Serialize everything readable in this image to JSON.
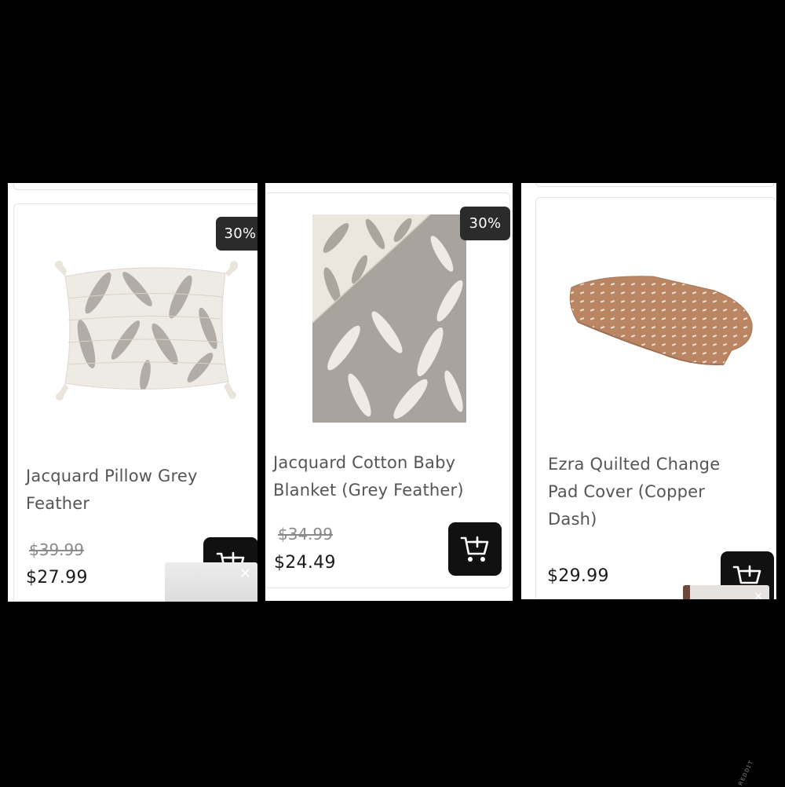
{
  "products": [
    {
      "title": "Jacquard Pillow Grey Feather",
      "badge": "30%",
      "original_price": "$39.99",
      "price": "$27.99",
      "image_icon": "pillow-image",
      "cart_icon": "add-to-cart-icon"
    },
    {
      "title": "Jacquard Cotton Baby Blanket (Grey Feather)",
      "badge": "30%",
      "original_price": "$34.99",
      "price": "$24.49",
      "image_icon": "blanket-image",
      "cart_icon": "add-to-cart-icon"
    },
    {
      "title": "Ezra Quilted Change Pad Cover (Copper Dash)",
      "price": "$29.99",
      "image_icon": "change-pad-image",
      "cart_icon": "add-to-cart-icon"
    }
  ],
  "colors": {
    "background": "#000000",
    "badge": "#2b2b2b",
    "cart_button": "#111111",
    "feather_grey": "#a39e98",
    "copper": "#b98563"
  }
}
